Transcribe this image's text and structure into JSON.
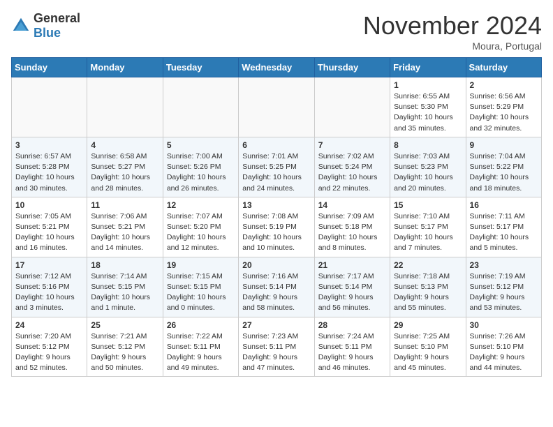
{
  "header": {
    "logo": {
      "general": "General",
      "blue": "Blue"
    },
    "title": "November 2024",
    "location": "Moura, Portugal"
  },
  "weekdays": [
    "Sunday",
    "Monday",
    "Tuesday",
    "Wednesday",
    "Thursday",
    "Friday",
    "Saturday"
  ],
  "weeks": [
    [
      {
        "day": "",
        "info": ""
      },
      {
        "day": "",
        "info": ""
      },
      {
        "day": "",
        "info": ""
      },
      {
        "day": "",
        "info": ""
      },
      {
        "day": "",
        "info": ""
      },
      {
        "day": "1",
        "info": "Sunrise: 6:55 AM\nSunset: 5:30 PM\nDaylight: 10 hours and 35 minutes."
      },
      {
        "day": "2",
        "info": "Sunrise: 6:56 AM\nSunset: 5:29 PM\nDaylight: 10 hours and 32 minutes."
      }
    ],
    [
      {
        "day": "3",
        "info": "Sunrise: 6:57 AM\nSunset: 5:28 PM\nDaylight: 10 hours and 30 minutes."
      },
      {
        "day": "4",
        "info": "Sunrise: 6:58 AM\nSunset: 5:27 PM\nDaylight: 10 hours and 28 minutes."
      },
      {
        "day": "5",
        "info": "Sunrise: 7:00 AM\nSunset: 5:26 PM\nDaylight: 10 hours and 26 minutes."
      },
      {
        "day": "6",
        "info": "Sunrise: 7:01 AM\nSunset: 5:25 PM\nDaylight: 10 hours and 24 minutes."
      },
      {
        "day": "7",
        "info": "Sunrise: 7:02 AM\nSunset: 5:24 PM\nDaylight: 10 hours and 22 minutes."
      },
      {
        "day": "8",
        "info": "Sunrise: 7:03 AM\nSunset: 5:23 PM\nDaylight: 10 hours and 20 minutes."
      },
      {
        "day": "9",
        "info": "Sunrise: 7:04 AM\nSunset: 5:22 PM\nDaylight: 10 hours and 18 minutes."
      }
    ],
    [
      {
        "day": "10",
        "info": "Sunrise: 7:05 AM\nSunset: 5:21 PM\nDaylight: 10 hours and 16 minutes."
      },
      {
        "day": "11",
        "info": "Sunrise: 7:06 AM\nSunset: 5:21 PM\nDaylight: 10 hours and 14 minutes."
      },
      {
        "day": "12",
        "info": "Sunrise: 7:07 AM\nSunset: 5:20 PM\nDaylight: 10 hours and 12 minutes."
      },
      {
        "day": "13",
        "info": "Sunrise: 7:08 AM\nSunset: 5:19 PM\nDaylight: 10 hours and 10 minutes."
      },
      {
        "day": "14",
        "info": "Sunrise: 7:09 AM\nSunset: 5:18 PM\nDaylight: 10 hours and 8 minutes."
      },
      {
        "day": "15",
        "info": "Sunrise: 7:10 AM\nSunset: 5:17 PM\nDaylight: 10 hours and 7 minutes."
      },
      {
        "day": "16",
        "info": "Sunrise: 7:11 AM\nSunset: 5:17 PM\nDaylight: 10 hours and 5 minutes."
      }
    ],
    [
      {
        "day": "17",
        "info": "Sunrise: 7:12 AM\nSunset: 5:16 PM\nDaylight: 10 hours and 3 minutes."
      },
      {
        "day": "18",
        "info": "Sunrise: 7:14 AM\nSunset: 5:15 PM\nDaylight: 10 hours and 1 minute."
      },
      {
        "day": "19",
        "info": "Sunrise: 7:15 AM\nSunset: 5:15 PM\nDaylight: 10 hours and 0 minutes."
      },
      {
        "day": "20",
        "info": "Sunrise: 7:16 AM\nSunset: 5:14 PM\nDaylight: 9 hours and 58 minutes."
      },
      {
        "day": "21",
        "info": "Sunrise: 7:17 AM\nSunset: 5:14 PM\nDaylight: 9 hours and 56 minutes."
      },
      {
        "day": "22",
        "info": "Sunrise: 7:18 AM\nSunset: 5:13 PM\nDaylight: 9 hours and 55 minutes."
      },
      {
        "day": "23",
        "info": "Sunrise: 7:19 AM\nSunset: 5:12 PM\nDaylight: 9 hours and 53 minutes."
      }
    ],
    [
      {
        "day": "24",
        "info": "Sunrise: 7:20 AM\nSunset: 5:12 PM\nDaylight: 9 hours and 52 minutes."
      },
      {
        "day": "25",
        "info": "Sunrise: 7:21 AM\nSunset: 5:12 PM\nDaylight: 9 hours and 50 minutes."
      },
      {
        "day": "26",
        "info": "Sunrise: 7:22 AM\nSunset: 5:11 PM\nDaylight: 9 hours and 49 minutes."
      },
      {
        "day": "27",
        "info": "Sunrise: 7:23 AM\nSunset: 5:11 PM\nDaylight: 9 hours and 47 minutes."
      },
      {
        "day": "28",
        "info": "Sunrise: 7:24 AM\nSunset: 5:11 PM\nDaylight: 9 hours and 46 minutes."
      },
      {
        "day": "29",
        "info": "Sunrise: 7:25 AM\nSunset: 5:10 PM\nDaylight: 9 hours and 45 minutes."
      },
      {
        "day": "30",
        "info": "Sunrise: 7:26 AM\nSunset: 5:10 PM\nDaylight: 9 hours and 44 minutes."
      }
    ]
  ]
}
